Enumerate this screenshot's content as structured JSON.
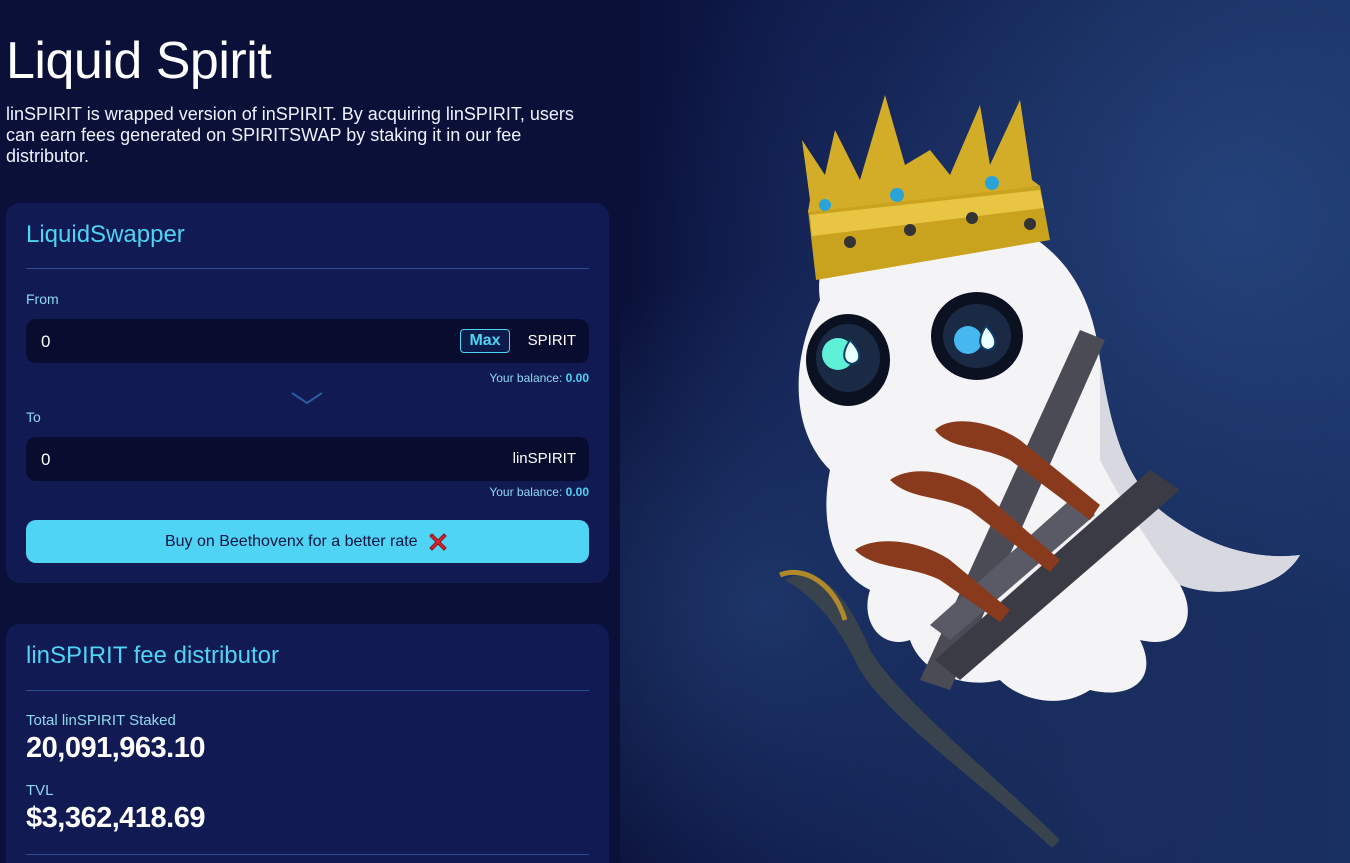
{
  "header": {
    "title": "Liquid Spirit",
    "description": "linSPIRIT is wrapped version of inSPIRIT. By acquiring linSPIRIT, users can earn fees generated on SPIRITSWAP by staking it in our fee distributor."
  },
  "swapper": {
    "title": "LiquidSwapper",
    "from": {
      "label": "From",
      "value": "0",
      "max_label": "Max",
      "token": "SPIRIT",
      "balance_label": "Your balance:",
      "balance_value": "0.00"
    },
    "to": {
      "label": "To",
      "value": "0",
      "token": "linSPIRIT",
      "balance_label": "Your balance:",
      "balance_value": "0.00"
    },
    "buy_button_label": "Buy on Beethovenx for a better rate"
  },
  "distributor": {
    "title": "linSPIRIT fee distributor",
    "total_staked_label": "Total linSPIRIT Staked",
    "total_staked_value": "20,091,963.10",
    "tvl_label": "TVL",
    "tvl_value": "$3,362,418.69"
  },
  "icons": {
    "swap_arrow": "chevron-down-icon",
    "buy_close": "red-x-icon",
    "hero": "ghost-king-illustration"
  },
  "colors": {
    "background": "#0a1038",
    "card": "#111a52",
    "accent": "#4fd4f5",
    "input": "#080d30"
  }
}
